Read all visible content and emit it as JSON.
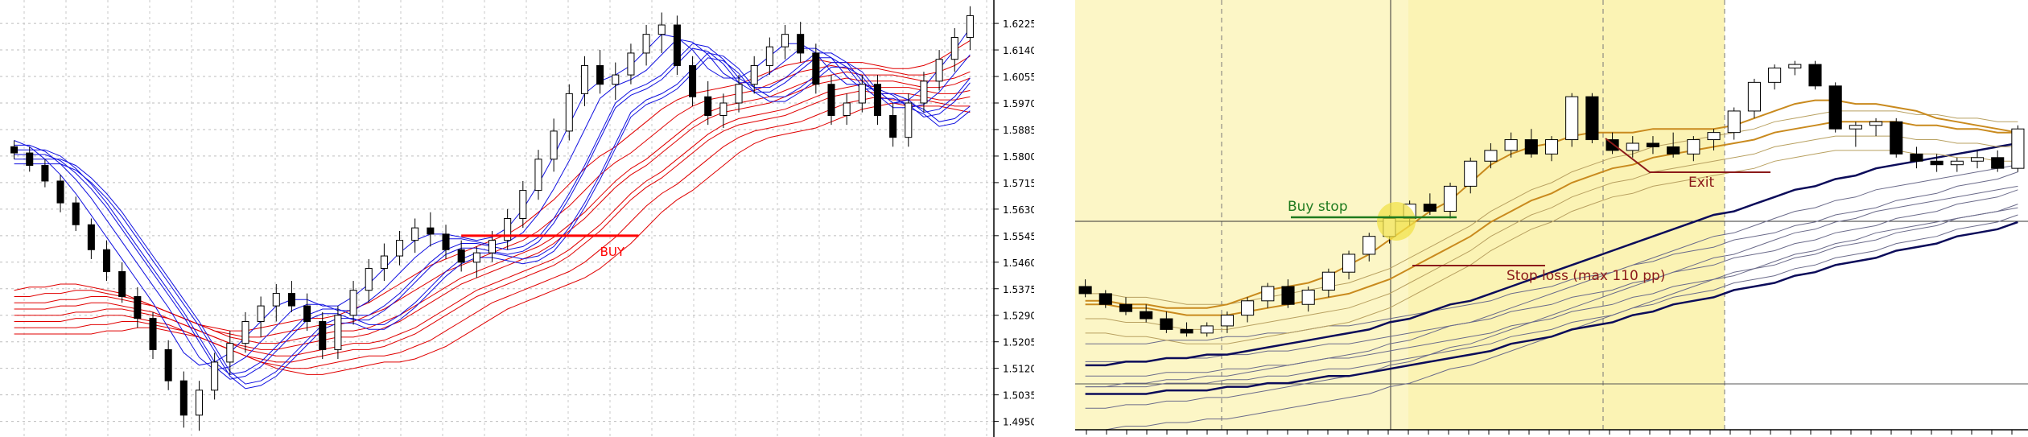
{
  "chart_data": [
    {
      "type": "candlestick",
      "title": "",
      "ylim": [
        1.49,
        1.63
      ],
      "y_ticks": [
        "1.6225",
        "1.6140",
        "1.6055",
        "1.5970",
        "1.5885",
        "1.5800",
        "1.5715",
        "1.5630",
        "1.5545",
        "1.5460",
        "1.5375",
        "1.5290",
        "1.5205",
        "1.5120",
        "1.5035",
        "1.4950"
      ],
      "grid": true,
      "bars": [
        [
          1.583,
          1.585,
          1.579,
          1.581
        ],
        [
          1.581,
          1.583,
          1.575,
          1.577
        ],
        [
          1.577,
          1.579,
          1.57,
          1.572
        ],
        [
          1.572,
          1.574,
          1.562,
          1.565
        ],
        [
          1.565,
          1.567,
          1.556,
          1.558
        ],
        [
          1.558,
          1.56,
          1.547,
          1.55
        ],
        [
          1.55,
          1.553,
          1.54,
          1.543
        ],
        [
          1.543,
          1.546,
          1.533,
          1.535
        ],
        [
          1.535,
          1.538,
          1.525,
          1.528
        ],
        [
          1.528,
          1.53,
          1.515,
          1.518
        ],
        [
          1.518,
          1.521,
          1.505,
          1.508
        ],
        [
          1.508,
          1.511,
          1.493,
          1.497
        ],
        [
          1.497,
          1.508,
          1.492,
          1.505
        ],
        [
          1.505,
          1.517,
          1.502,
          1.514
        ],
        [
          1.514,
          1.524,
          1.51,
          1.52
        ],
        [
          1.52,
          1.53,
          1.517,
          1.527
        ],
        [
          1.527,
          1.535,
          1.522,
          1.532
        ],
        [
          1.532,
          1.539,
          1.527,
          1.536
        ],
        [
          1.536,
          1.54,
          1.53,
          1.532
        ],
        [
          1.532,
          1.536,
          1.524,
          1.527
        ],
        [
          1.527,
          1.53,
          1.515,
          1.518
        ],
        [
          1.518,
          1.532,
          1.515,
          1.529
        ],
        [
          1.529,
          1.54,
          1.526,
          1.537
        ],
        [
          1.537,
          1.547,
          1.533,
          1.544
        ],
        [
          1.544,
          1.552,
          1.54,
          1.548
        ],
        [
          1.548,
          1.556,
          1.545,
          1.553
        ],
        [
          1.553,
          1.56,
          1.549,
          1.557
        ],
        [
          1.557,
          1.562,
          1.551,
          1.555
        ],
        [
          1.555,
          1.558,
          1.547,
          1.55
        ],
        [
          1.55,
          1.553,
          1.543,
          1.546
        ],
        [
          1.546,
          1.551,
          1.541,
          1.549
        ],
        [
          1.549,
          1.556,
          1.546,
          1.553
        ],
        [
          1.553,
          1.563,
          1.55,
          1.56
        ],
        [
          1.56,
          1.572,
          1.557,
          1.569
        ],
        [
          1.569,
          1.582,
          1.566,
          1.579
        ],
        [
          1.579,
          1.592,
          1.575,
          1.588
        ],
        [
          1.588,
          1.603,
          1.585,
          1.6
        ],
        [
          1.6,
          1.612,
          1.596,
          1.609
        ],
        [
          1.609,
          1.614,
          1.6,
          1.603
        ],
        [
          1.603,
          1.61,
          1.598,
          1.606
        ],
        [
          1.606,
          1.616,
          1.603,
          1.613
        ],
        [
          1.613,
          1.622,
          1.609,
          1.619
        ],
        [
          1.619,
          1.626,
          1.613,
          1.622
        ],
        [
          1.622,
          1.625,
          1.606,
          1.609
        ],
        [
          1.609,
          1.612,
          1.596,
          1.599
        ],
        [
          1.599,
          1.604,
          1.59,
          1.593
        ],
        [
          1.593,
          1.6,
          1.589,
          1.597
        ],
        [
          1.597,
          1.606,
          1.594,
          1.603
        ],
        [
          1.603,
          1.612,
          1.6,
          1.609
        ],
        [
          1.609,
          1.618,
          1.606,
          1.615
        ],
        [
          1.615,
          1.622,
          1.611,
          1.619
        ],
        [
          1.619,
          1.623,
          1.61,
          1.613
        ],
        [
          1.613,
          1.616,
          1.6,
          1.603
        ],
        [
          1.603,
          1.606,
          1.59,
          1.593
        ],
        [
          1.593,
          1.6,
          1.59,
          1.597
        ],
        [
          1.597,
          1.606,
          1.594,
          1.603
        ],
        [
          1.603,
          1.606,
          1.59,
          1.593
        ],
        [
          1.593,
          1.597,
          1.583,
          1.586
        ],
        [
          1.586,
          1.6,
          1.583,
          1.597
        ],
        [
          1.597,
          1.607,
          1.594,
          1.604
        ],
        [
          1.604,
          1.614,
          1.601,
          1.611
        ],
        [
          1.611,
          1.621,
          1.607,
          1.618
        ],
        [
          1.618,
          1.628,
          1.614,
          1.625
        ]
      ],
      "ma_blue": [
        1.582,
        1.58,
        1.576,
        1.571,
        1.565,
        1.558,
        1.551,
        1.544,
        1.537,
        1.53,
        1.522,
        1.514,
        1.51,
        1.511,
        1.514,
        1.519,
        1.524,
        1.529,
        1.531,
        1.531,
        1.529,
        1.529,
        1.532,
        1.536,
        1.541,
        1.546,
        1.55,
        1.552,
        1.552,
        1.551,
        1.55,
        1.551,
        1.554,
        1.56,
        1.568,
        1.577,
        1.587,
        1.597,
        1.601,
        1.603,
        1.606,
        1.611,
        1.616,
        1.615,
        1.611,
        1.605,
        1.602,
        1.602,
        1.605,
        1.609,
        1.613,
        1.613,
        1.61,
        1.604,
        1.6,
        1.6,
        1.598,
        1.594,
        1.595,
        1.599,
        1.605,
        1.611,
        1.618
      ],
      "ma_red": [
        1.533,
        1.534,
        1.534,
        1.535,
        1.535,
        1.534,
        1.533,
        1.532,
        1.53,
        1.528,
        1.526,
        1.524,
        1.522,
        1.521,
        1.52,
        1.52,
        1.521,
        1.522,
        1.523,
        1.524,
        1.524,
        1.525,
        1.527,
        1.529,
        1.532,
        1.535,
        1.538,
        1.541,
        1.543,
        1.545,
        1.547,
        1.549,
        1.551,
        1.554,
        1.558,
        1.562,
        1.567,
        1.572,
        1.576,
        1.579,
        1.583,
        1.587,
        1.591,
        1.594,
        1.596,
        1.597,
        1.598,
        1.599,
        1.601,
        1.603,
        1.605,
        1.606,
        1.607,
        1.606,
        1.606,
        1.606,
        1.605,
        1.604,
        1.604,
        1.605,
        1.607,
        1.61,
        1.613
      ],
      "annotations": [
        {
          "label": "BUY",
          "color": "#ff0000"
        }
      ]
    },
    {
      "type": "candlestick",
      "title": "",
      "grid": true,
      "bars": [
        [
          50,
          52,
          47,
          48
        ],
        [
          48,
          49,
          44,
          45
        ],
        [
          45,
          47,
          42,
          43
        ],
        [
          43,
          45,
          40,
          41
        ],
        [
          41,
          43,
          37,
          38
        ],
        [
          38,
          40,
          36,
          37
        ],
        [
          37,
          40,
          36,
          39
        ],
        [
          39,
          43,
          37,
          42
        ],
        [
          42,
          47,
          40,
          46
        ],
        [
          46,
          51,
          44,
          50
        ],
        [
          50,
          52,
          44,
          45
        ],
        [
          45,
          50,
          43,
          49
        ],
        [
          49,
          55,
          47,
          54
        ],
        [
          54,
          60,
          52,
          59
        ],
        [
          59,
          65,
          57,
          64
        ],
        [
          64,
          70,
          62,
          69
        ],
        [
          69,
          74,
          67,
          73
        ],
        [
          73,
          76,
          70,
          71
        ],
        [
          71,
          79,
          69,
          78
        ],
        [
          78,
          86,
          76,
          85
        ],
        [
          85,
          90,
          83,
          88
        ],
        [
          88,
          93,
          86,
          91
        ],
        [
          91,
          94,
          86,
          87
        ],
        [
          87,
          92,
          85,
          91
        ],
        [
          91,
          104,
          89,
          103
        ],
        [
          103,
          104,
          90,
          91
        ],
        [
          91,
          93,
          87,
          88
        ],
        [
          88,
          92,
          86,
          90
        ],
        [
          90,
          92,
          87,
          89
        ],
        [
          89,
          93,
          86,
          87
        ],
        [
          87,
          92,
          85,
          91
        ],
        [
          91,
          94,
          88,
          93
        ],
        [
          93,
          100,
          91,
          99
        ],
        [
          99,
          108,
          97,
          107
        ],
        [
          107,
          112,
          105,
          111
        ],
        [
          111,
          113,
          109,
          112
        ],
        [
          112,
          113,
          105,
          106
        ],
        [
          106,
          107,
          93,
          94
        ],
        [
          94,
          96,
          89,
          95
        ],
        [
          95,
          97,
          92,
          96
        ],
        [
          96,
          97,
          86,
          87
        ],
        [
          87,
          89,
          83,
          85
        ],
        [
          85,
          87,
          82,
          84
        ],
        [
          84,
          86,
          82,
          85
        ],
        [
          85,
          88,
          83,
          86
        ],
        [
          86,
          88,
          82,
          83
        ],
        [
          83,
          95,
          82,
          94
        ]
      ],
      "ma_gold": [
        46,
        46,
        45,
        45,
        44,
        44,
        44,
        45,
        47,
        49,
        50,
        51,
        53,
        56,
        59,
        63,
        67,
        71,
        74,
        79,
        84,
        87,
        89,
        90,
        92,
        93,
        93,
        93,
        94,
        94,
        94,
        94,
        95,
        97,
        99,
        101,
        102,
        102,
        101,
        101,
        100,
        99,
        97,
        96,
        95,
        94,
        93
      ],
      "ma_gold_slow": [
        45,
        45,
        44,
        44,
        43,
        42,
        42,
        42,
        43,
        44,
        45,
        46,
        47,
        48,
        50,
        52,
        55,
        58,
        61,
        64,
        68,
        71,
        74,
        76,
        79,
        81,
        83,
        84,
        86,
        87,
        88,
        89,
        90,
        91,
        93,
        94,
        95,
        96,
        96,
        96,
        96,
        95,
        95,
        94,
        94,
        93,
        93
      ],
      "ma_navy": [
        28,
        28,
        29,
        29,
        30,
        30,
        31,
        31,
        32,
        33,
        34,
        35,
        36,
        37,
        38,
        40,
        41,
        43,
        45,
        46,
        48,
        50,
        52,
        54,
        56,
        58,
        60,
        62,
        64,
        66,
        68,
        70,
        71,
        73,
        75,
        77,
        78,
        80,
        81,
        83,
        84,
        85,
        86,
        87,
        88,
        89,
        90
      ],
      "ma_navy_slow": [
        20,
        20,
        20,
        20,
        21,
        21,
        21,
        22,
        22,
        23,
        23,
        24,
        25,
        25,
        26,
        27,
        28,
        29,
        30,
        31,
        32,
        34,
        35,
        36,
        38,
        39,
        40,
        42,
        43,
        45,
        46,
        47,
        49,
        50,
        51,
        53,
        54,
        56,
        57,
        58,
        60,
        61,
        62,
        64,
        65,
        66,
        68
      ],
      "annotations": [
        {
          "label": "Buy stop",
          "color": "#1e7a1e"
        },
        {
          "label": "Stop loss (max 110 pp)",
          "color": "#8b1a1a"
        },
        {
          "label": "Exit",
          "color": "#8b1a1a"
        }
      ]
    }
  ]
}
